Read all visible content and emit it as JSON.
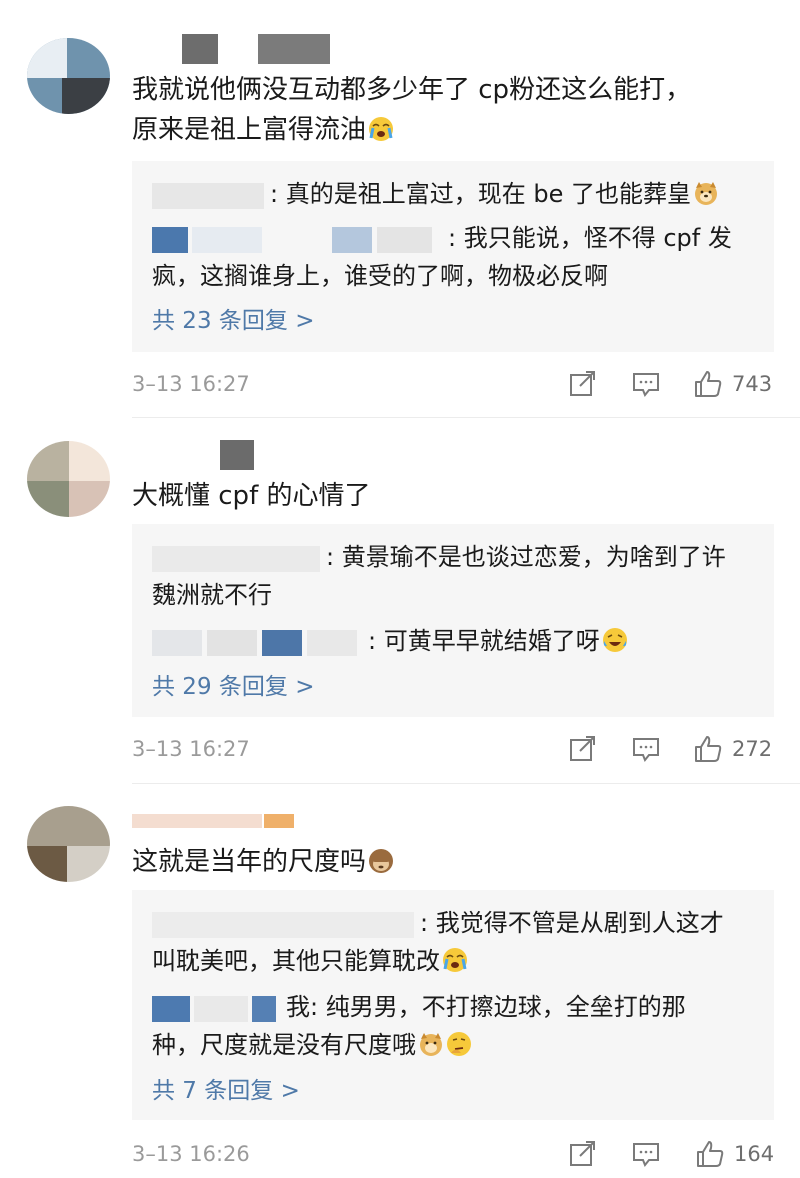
{
  "comments": [
    {
      "username": "",
      "text": "我就说他俩没互动都多少年了 cp粉还这么能打，",
      "text_line2": "原来是祖上富得流油",
      "text_emoji": "crying-face-emoji",
      "replies": [
        {
          "text": ": 真的是祖上富过，现在 be 了也能葬皇",
          "emoji": "doge-emoji"
        },
        {
          "text": ": 我只能说，怪不得 cpf 发",
          "text_line2": "疯，这搁谁身上，谁受的了啊，物极必反啊"
        }
      ],
      "more_replies": "共 23 条回复 >",
      "time": "3–13 16:27",
      "likes": "743"
    },
    {
      "username": "",
      "text": "大概懂 cpf 的心情了",
      "replies": [
        {
          "text": ": 黄景瑜不是也谈过恋爱，为啥到了许",
          "text_line2": "魏洲就不行"
        },
        {
          "text": ": 可黄早早就结婚了呀",
          "emoji": "laughing-tears-emoji"
        }
      ],
      "more_replies": "共 29 条回复 >",
      "time": "3–13 16:27",
      "likes": "272"
    },
    {
      "username": "",
      "text": "这就是当年的尺度吗",
      "text_emoji": "see-no-evil-monkey-emoji",
      "replies": [
        {
          "text": ": 我觉得不管是从剧到人这才",
          "text_line2": "叫耽美吧，其他只能算耽改",
          "emoji": "crying-face-emoji"
        },
        {
          "text": "我: 纯男男，不打擦边球，全垒打的那",
          "text_line2": "种，尺度就是没有尺度哦",
          "emoji": "doge-thinking-emoji"
        }
      ],
      "more_replies": "共 7 条回复 >",
      "time": "3–13 16:26",
      "likes": "164"
    }
  ],
  "icons": {
    "share": "share-icon",
    "comment": "comment-icon",
    "like": "thumbs-up-icon"
  },
  "colors": {
    "link": "#4f79a8",
    "meta": "#9a9a9a",
    "reply_bg": "#f6f6f6"
  }
}
